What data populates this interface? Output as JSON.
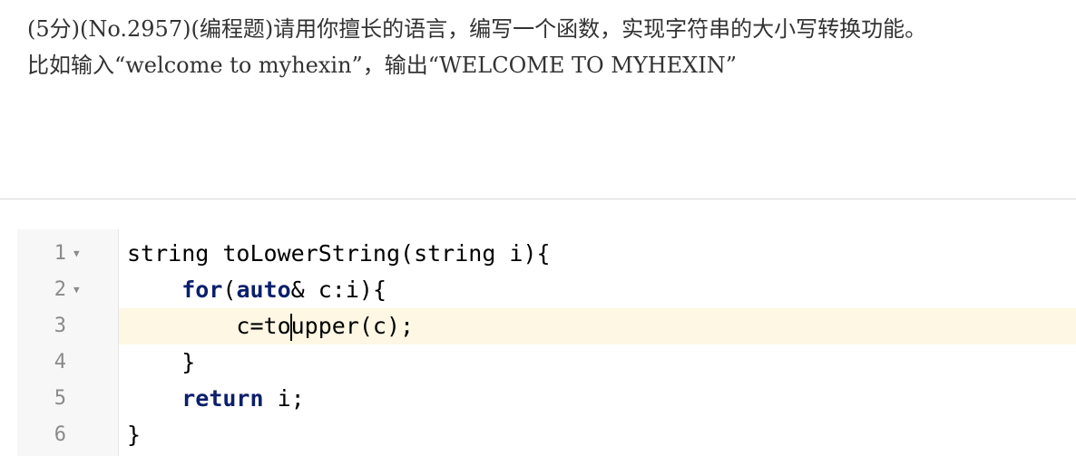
{
  "question": {
    "line1": "(5分)(No.2957)(编程题)请用你擅长的语言，编写一个函数，实现字符串的大小写转换功能。",
    "line2": "比如输入“welcome to myhexin”，输出“WELCOME TO MYHEXIN”"
  },
  "editor": {
    "active_line": 3,
    "gutter": [
      {
        "number": "1",
        "fold": "▼"
      },
      {
        "number": "2",
        "fold": "▼"
      },
      {
        "number": "3",
        "fold": ""
      },
      {
        "number": "4",
        "fold": ""
      },
      {
        "number": "5",
        "fold": ""
      },
      {
        "number": "6",
        "fold": ""
      }
    ],
    "code": {
      "line1": "string toLowerString(string i){",
      "line2_indent": "    ",
      "line2_kw1": "for",
      "line2_mid": "(",
      "line2_kw2": "auto",
      "line2_rest": "& c:i){",
      "line3_before_cursor": "        c=to",
      "line3_after_cursor": "upper(c);",
      "line4": "    }",
      "line5_indent": "    ",
      "line5_kw": "return",
      "line5_rest": " i;",
      "line6": "}"
    },
    "colors": {
      "keyword": "#0b1f6b",
      "active_line_bg": "#fdf7e3",
      "gutter_bg": "#f7f7f7"
    }
  }
}
